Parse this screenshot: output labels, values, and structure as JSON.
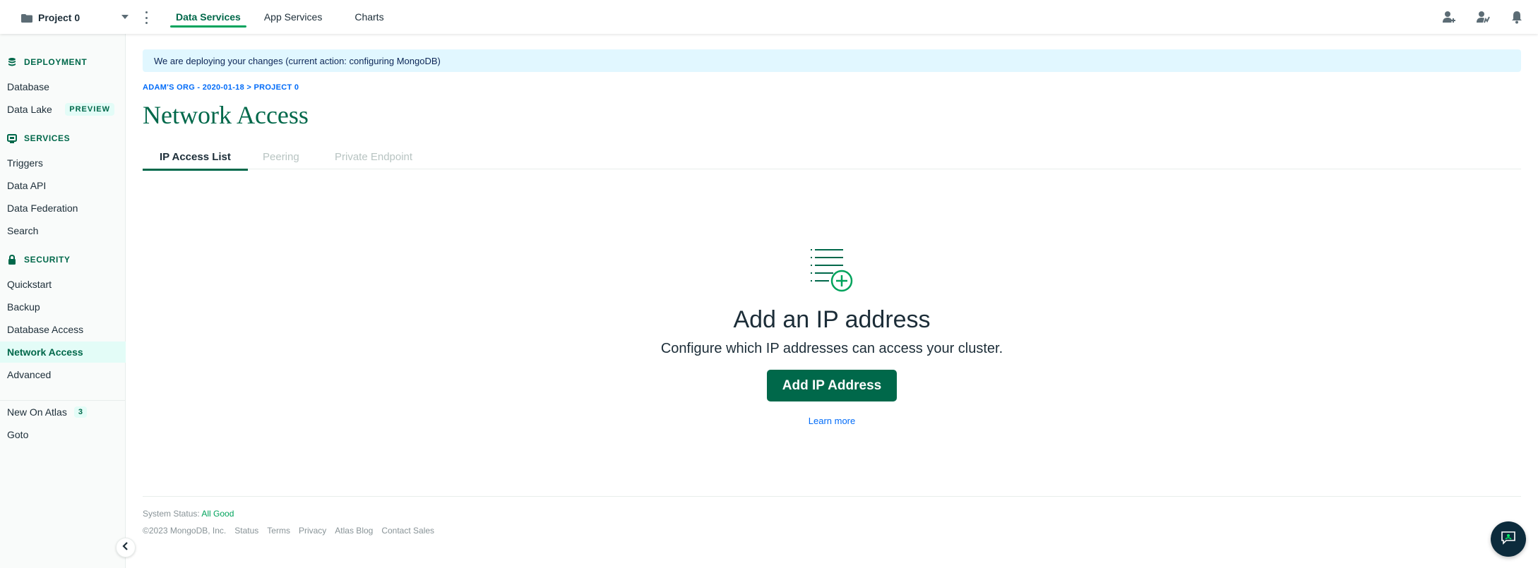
{
  "topbar": {
    "project_name": "Project 0",
    "nav": [
      {
        "label": "Data Services",
        "active": true
      },
      {
        "label": "App Services",
        "active": false
      },
      {
        "label": "Charts",
        "active": false
      }
    ],
    "icons": [
      "invite-user-icon",
      "activity-feed-icon",
      "notifications-bell-icon"
    ]
  },
  "sidebar": {
    "deployment_header": "DEPLOYMENT",
    "deployment_items": [
      {
        "label": "Database"
      },
      {
        "label": "Data Lake",
        "badge": "PREVIEW"
      }
    ],
    "services_header": "SERVICES",
    "services_items": [
      {
        "label": "Triggers"
      },
      {
        "label": "Data API"
      },
      {
        "label": "Data Federation"
      },
      {
        "label": "Search"
      }
    ],
    "security_header": "SECURITY",
    "security_items": [
      {
        "label": "Quickstart"
      },
      {
        "label": "Backup"
      },
      {
        "label": "Database Access"
      },
      {
        "label": "Network Access",
        "active": true
      },
      {
        "label": "Advanced"
      }
    ],
    "extra_items": [
      {
        "label": "New On Atlas",
        "badge": "3"
      },
      {
        "label": "Goto"
      }
    ]
  },
  "banner": {
    "text": "We are deploying your changes (current action: configuring MongoDB)"
  },
  "breadcrumb": "ADAM'S ORG - 2020-01-18 > PROJECT 0",
  "page_title": "Network Access",
  "tabs": [
    {
      "label": "IP Access List",
      "active": true
    },
    {
      "label": "Peering",
      "active": false
    },
    {
      "label": "Private Endpoint",
      "active": false
    }
  ],
  "empty_state": {
    "title": "Add an IP address",
    "description": "Configure which IP addresses can access your cluster.",
    "button_label": "Add IP Address",
    "link_label": "Learn more"
  },
  "footer": {
    "status_label": "System Status:",
    "status_value": "All Good",
    "copyright": "©2023 MongoDB, Inc.",
    "links": [
      "Status",
      "Terms",
      "Privacy",
      "Atlas Blog",
      "Contact Sales"
    ]
  },
  "colors": {
    "brand_green": "#00684a",
    "accent_green": "#00a35c",
    "link_blue": "#016bf8",
    "banner_bg": "#e1f7ff"
  }
}
